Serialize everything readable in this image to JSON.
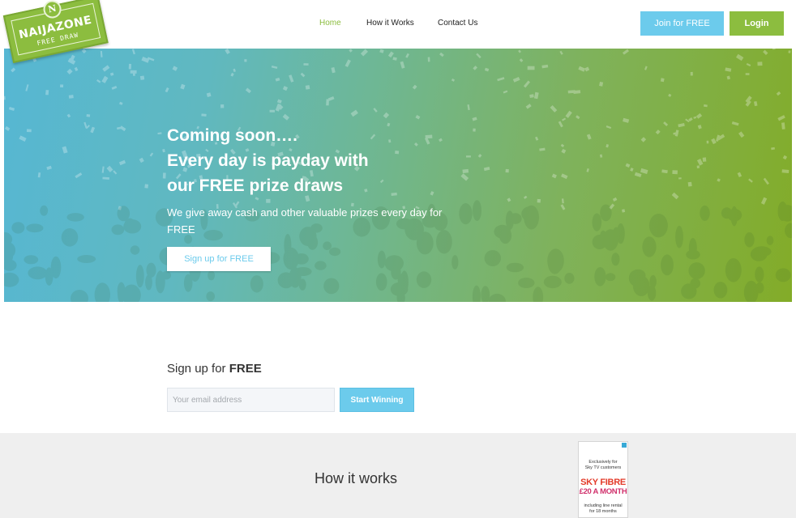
{
  "brand": {
    "logo_title": "NAIJAZONE",
    "logo_sub": "FREE DRAW",
    "logo_mark": "N",
    "primary_color": "#8cbd3f",
    "accent_color": "#6ccbec"
  },
  "nav": {
    "items": [
      {
        "label": "Home",
        "active": true
      },
      {
        "label": "How it Works",
        "active": false
      },
      {
        "label": "Contact Us",
        "active": false
      }
    ]
  },
  "header": {
    "join_label": "Join for FREE",
    "login_label": "Login"
  },
  "hero": {
    "title_lines": [
      "Coming soon….",
      "Every day is payday with",
      "our FREE prize draws"
    ],
    "subtitle": "We give away cash and other valuable prizes every day for FREE",
    "cta_label": "Sign up for FREE"
  },
  "signup": {
    "heading_prefix": "Sign up for ",
    "heading_bold": "FREE",
    "email_placeholder": "Your email address",
    "submit_label": "Start Winning"
  },
  "how": {
    "title": "How it works"
  },
  "ad": {
    "line1": "Exclusively for",
    "line2": "Sky TV customers",
    "big1": "SKY FIBRE",
    "big2": "£20 A MONTH",
    "line3": "including line rental",
    "line4": "for 18 months"
  }
}
